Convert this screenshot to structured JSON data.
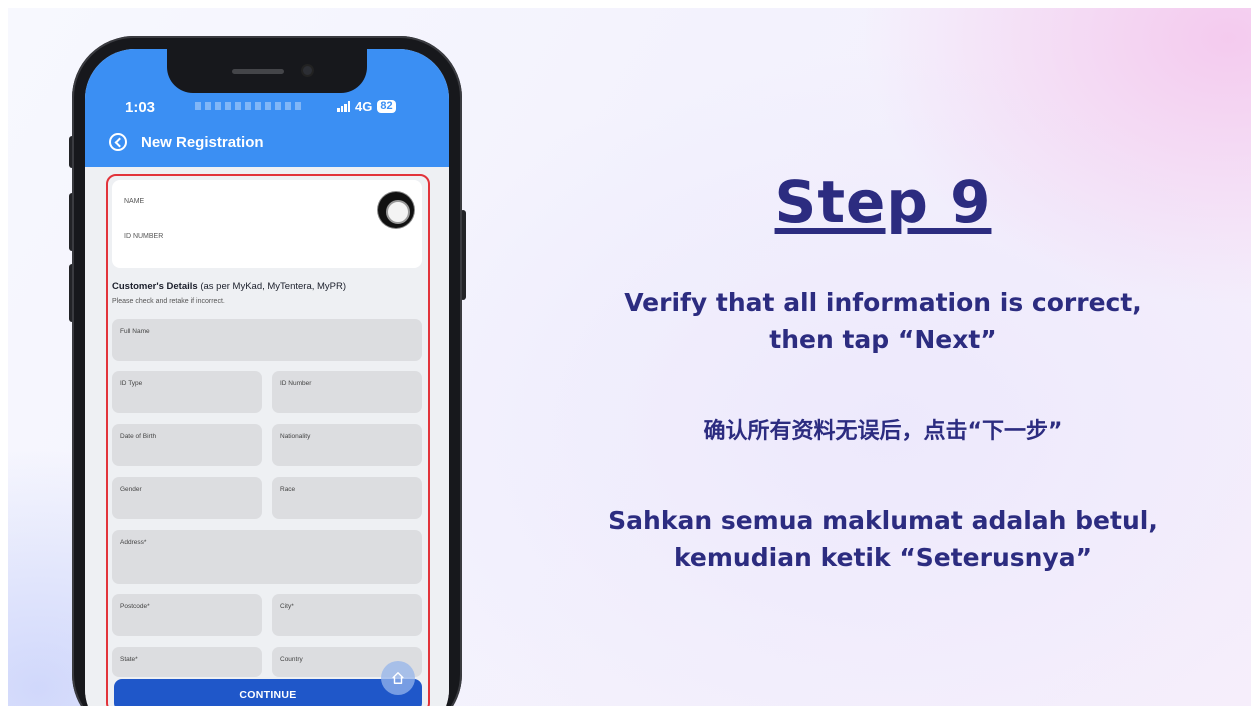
{
  "phone": {
    "status_bar": {
      "time": "1:03",
      "network": "4G",
      "battery": "82"
    },
    "header": {
      "title": "New Registration"
    },
    "id_card": {
      "name_label": "NAME",
      "id_label": "ID NUMBER"
    },
    "section": {
      "title_bold": "Customer's Details",
      "title_rest": " (as per MyKad, MyTentera, MyPR)",
      "subtitle": "Please check and retake if incorrect."
    },
    "fields": {
      "full_name": "Full Name",
      "id_type": "ID Type",
      "id_number": "ID Number",
      "dob": "Date of Birth",
      "nationality": "Nationality",
      "gender": "Gender",
      "race": "Race",
      "address": "Address*",
      "postcode": "Postcode*",
      "city": "City*",
      "state": "State*",
      "country": "Country"
    },
    "continue_label": "CONTINUE"
  },
  "slide": {
    "step_title": "Step 9",
    "instruction_en": "Verify that all information is correct, then tap “Next”",
    "instruction_zh": "确认所有资料无误后，点击“下一步”",
    "instruction_ms": "Sahkan semua maklumat adalah betul, kemudian ketik “Seterusnya”"
  },
  "colors": {
    "header_blue": "#3b8ff3",
    "button_blue": "#1f57c9",
    "highlight_red": "#e2333a",
    "title_navy": "#2c2c80"
  }
}
